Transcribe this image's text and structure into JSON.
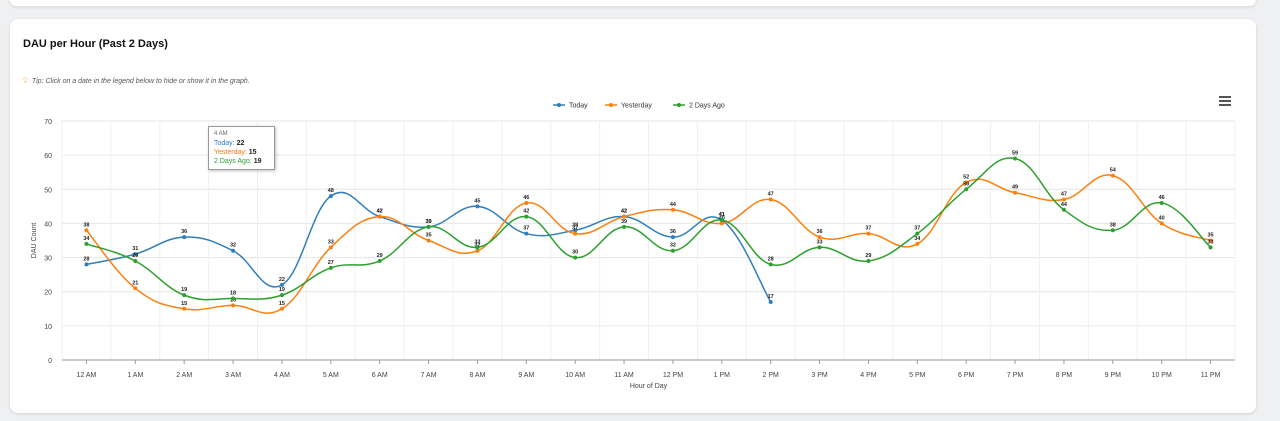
{
  "title": "DAU per Hour (Past 2 Days)",
  "tip": "Tip: Click on a date in the legend below to hide or show it in the graph.",
  "menu_icon": "hamburger-menu-icon",
  "chart_data": {
    "type": "line",
    "title": "DAU per Hour (Past 2 Days)",
    "xlabel": "Hour of Day",
    "ylabel": "DAU Count",
    "ylim": [
      0,
      70
    ],
    "yticks": [
      0,
      10,
      20,
      30,
      40,
      50,
      60,
      70
    ],
    "grid": true,
    "legend_position": "top-center",
    "categories": [
      "12 AM",
      "1 AM",
      "2 AM",
      "3 AM",
      "4 AM",
      "5 AM",
      "6 AM",
      "7 AM",
      "8 AM",
      "9 AM",
      "10 AM",
      "11 AM",
      "12 PM",
      "1 PM",
      "2 PM",
      "3 PM",
      "4 PM",
      "5 PM",
      "6 PM",
      "7 PM",
      "8 PM",
      "9 PM",
      "10 PM",
      "11 PM"
    ],
    "series": [
      {
        "name": "Today",
        "color": "#2f7ebc",
        "values": [
          28,
          31,
          36,
          32,
          22,
          48,
          42,
          39,
          45,
          37,
          38,
          42,
          36,
          41,
          17,
          null,
          null,
          null,
          null,
          null,
          null,
          null,
          null,
          null
        ]
      },
      {
        "name": "Yesterday",
        "color": "#ff7f0e",
        "values": [
          38,
          21,
          15,
          16,
          15,
          33,
          42,
          35,
          32,
          46,
          37,
          42,
          44,
          40,
          47,
          36,
          37,
          34,
          52,
          49,
          47,
          54,
          40,
          35
        ]
      },
      {
        "name": "2 Days Ago",
        "color": "#2ca02c",
        "values": [
          34,
          29,
          19,
          18,
          19,
          27,
          29,
          39,
          33,
          42,
          30,
          39,
          32,
          41,
          28,
          33,
          29,
          37,
          50,
          59,
          44,
          38,
          46,
          33
        ]
      }
    ],
    "tooltip": {
      "header": "4 AM",
      "rows": [
        {
          "label": "Today",
          "value": "22"
        },
        {
          "label": "Yesterday",
          "value": "15"
        },
        {
          "label": "2 Days Ago",
          "value": "19"
        }
      ]
    }
  }
}
